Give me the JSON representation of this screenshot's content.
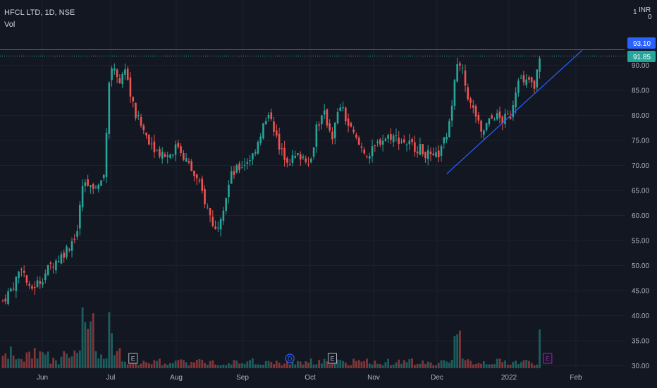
{
  "header": {
    "symbol_line": "HFCL LTD, 1D, NSE",
    "volume_label": "Vol",
    "currency": "INR",
    "one": "1",
    "zero": "0"
  },
  "price_labels": {
    "resistance": "93.10",
    "last": "91.85"
  },
  "colors": {
    "background": "#131722",
    "up": "#26a69a",
    "down": "#ef5350",
    "trendline": "#2962ff",
    "earnings_marker": "#b2b5be",
    "dividend_marker": "#2962ff",
    "earnings_upcoming": "#9c27b0"
  },
  "chart_data": {
    "type": "candlestick",
    "title": "HFCL LTD, 1D, NSE",
    "y_axis": {
      "ylim": [
        29.5,
        100
      ],
      "ticks": [
        "30.00",
        "35.00",
        "40.00",
        "45.00",
        "50.00",
        "55.00",
        "60.00",
        "65.00",
        "70.00",
        "75.00",
        "80.00",
        "85.00",
        "90.00"
      ]
    },
    "x_axis": {
      "tick_labels": [
        "Jun",
        "Jul",
        "Aug",
        "Sep",
        "Oct",
        "Nov",
        "Dec",
        "2022",
        "Feb"
      ]
    },
    "price_path": {
      "description_values": "closing price approximations over time (index 0 = late May 2021)",
      "anchors": [
        [
          0,
          43
        ],
        [
          4,
          46
        ],
        [
          7,
          50
        ],
        [
          10,
          45
        ],
        [
          14,
          47
        ],
        [
          18,
          50
        ],
        [
          22,
          52
        ],
        [
          25,
          54
        ],
        [
          28,
          57
        ],
        [
          30,
          66
        ],
        [
          33,
          66
        ],
        [
          36,
          66
        ],
        [
          38,
          68
        ],
        [
          40,
          87
        ],
        [
          42,
          90
        ],
        [
          44,
          86
        ],
        [
          46,
          90
        ],
        [
          48,
          84
        ],
        [
          50,
          80
        ],
        [
          54,
          76
        ],
        [
          58,
          73
        ],
        [
          62,
          72
        ],
        [
          66,
          74
        ],
        [
          70,
          70
        ],
        [
          74,
          66
        ],
        [
          78,
          60
        ],
        [
          80,
          57
        ],
        [
          83,
          62
        ],
        [
          86,
          68
        ],
        [
          90,
          70
        ],
        [
          94,
          72
        ],
        [
          98,
          78
        ],
        [
          101,
          80
        ],
        [
          104,
          73
        ],
        [
          108,
          71
        ],
        [
          112,
          72
        ],
        [
          116,
          71
        ],
        [
          118,
          78
        ],
        [
          121,
          80
        ],
        [
          124,
          76
        ],
        [
          127,
          82
        ],
        [
          130,
          78
        ],
        [
          134,
          74
        ],
        [
          138,
          72
        ],
        [
          142,
          75
        ],
        [
          146,
          76
        ],
        [
          150,
          75
        ],
        [
          154,
          74
        ],
        [
          158,
          73
        ],
        [
          162,
          71
        ],
        [
          165,
          73
        ],
        [
          168,
          78
        ],
        [
          170,
          88
        ],
        [
          172,
          91
        ],
        [
          174,
          86
        ],
        [
          176,
          82
        ],
        [
          178,
          80
        ],
        [
          180,
          76
        ],
        [
          182,
          78
        ],
        [
          185,
          80
        ],
        [
          188,
          79
        ],
        [
          191,
          80
        ],
        [
          194,
          88
        ],
        [
          196,
          86
        ],
        [
          198,
          87
        ],
        [
          200,
          85
        ],
        [
          202,
          92
        ]
      ]
    },
    "horizontal_line": {
      "value": 93.1
    },
    "trendline": {
      "from": [
        167,
        68.3
      ],
      "to": [
        218,
        93
      ]
    },
    "volume": {
      "max_relative": 1.0
    },
    "markers": [
      {
        "type": "E",
        "x_index": 49
      },
      {
        "type": "D",
        "x_index": 108
      },
      {
        "type": "E",
        "x_index": 124
      },
      {
        "type": "E",
        "x_index": 205
      }
    ]
  }
}
